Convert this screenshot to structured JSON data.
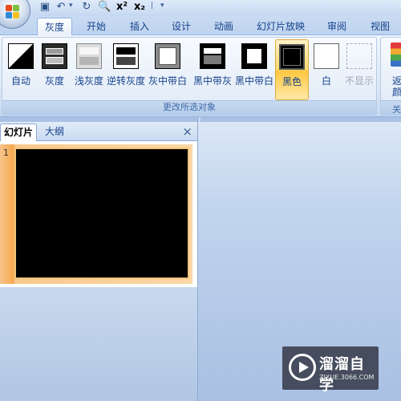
{
  "tabs": [
    {
      "label": "灰度",
      "active": true
    },
    {
      "label": "开始"
    },
    {
      "label": "插入"
    },
    {
      "label": "设计"
    },
    {
      "label": "动画"
    },
    {
      "label": "幻灯片放映"
    },
    {
      "label": "审阅"
    },
    {
      "label": "视图"
    }
  ],
  "ribbon": {
    "group_label": "更改所选对象",
    "buttons": [
      {
        "label": "自动",
        "icon": "auto-grayscale-icon"
      },
      {
        "label": "灰度",
        "icon": "grayscale-icon"
      },
      {
        "label": "浅灰度",
        "icon": "light-grayscale-icon"
      },
      {
        "label": "逆转灰度",
        "icon": "inverse-grayscale-icon"
      },
      {
        "label": "灰中带白",
        "icon": "gray-with-white-fill-icon"
      },
      {
        "label": "黑中带灰",
        "icon": "black-with-grayscale-fill-icon"
      },
      {
        "label": "黑中带白",
        "icon": "black-with-white-fill-icon"
      },
      {
        "label": "黑色",
        "icon": "black-icon",
        "selected": true
      },
      {
        "label": "白",
        "icon": "white-icon"
      },
      {
        "label": "不显示",
        "icon": "dont-show-icon",
        "disabled": true
      }
    ],
    "right_group_label_1": "返",
    "right_group_label_2": "颜色",
    "right_group_footer": "关"
  },
  "left_pane": {
    "tab_slides": "幻灯片",
    "tab_outline": "大纲",
    "close_symbol": "×",
    "slide_number": "1"
  },
  "watermark": {
    "title": "溜溜自学",
    "url": "ZIXUE.3066.COM"
  },
  "colors": {
    "accent": "#15428b",
    "selected_button": "#ffd86e",
    "thumbnail_highlight": "#f6a94f",
    "slide_fill": "#000000"
  }
}
